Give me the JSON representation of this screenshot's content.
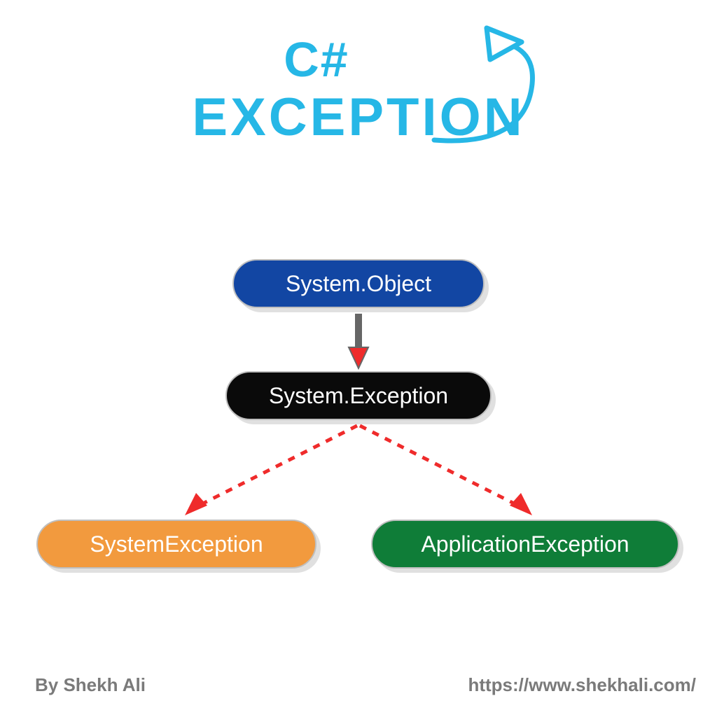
{
  "title": {
    "line1": "C#",
    "line2": "EXCEPTION"
  },
  "nodes": {
    "object": "System.Object",
    "exception": "System.Exception",
    "system": "SystemException",
    "application": "ApplicationException"
  },
  "footer": {
    "author": "By Shekh Ali",
    "url": "https://www.shekhali.com/"
  },
  "colors": {
    "title": "#26b7e6",
    "node_object": "#1246a3",
    "node_exception": "#0a0a0a",
    "node_system": "#f29a3e",
    "node_app": "#0f7d38",
    "arrow_red": "#ef2b2b",
    "footer": "#7a7a7a"
  },
  "chart_data": {
    "type": "diagram",
    "title": "C# EXCEPTION",
    "nodes": [
      {
        "id": "object",
        "label": "System.Object",
        "color": "#1246a3"
      },
      {
        "id": "exception",
        "label": "System.Exception",
        "color": "#0a0a0a"
      },
      {
        "id": "system",
        "label": "SystemException",
        "color": "#f29a3e"
      },
      {
        "id": "application",
        "label": "ApplicationException",
        "color": "#0f7d38"
      }
    ],
    "edges": [
      {
        "from": "object",
        "to": "exception",
        "style": "solid"
      },
      {
        "from": "exception",
        "to": "system",
        "style": "dashed"
      },
      {
        "from": "exception",
        "to": "application",
        "style": "dashed"
      }
    ]
  }
}
